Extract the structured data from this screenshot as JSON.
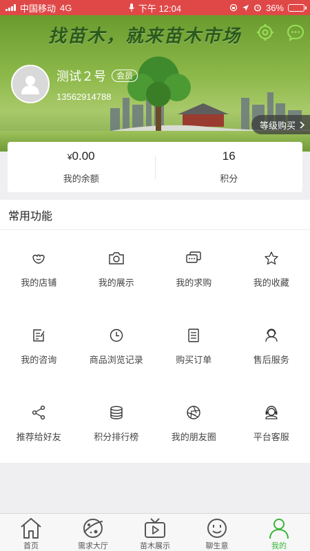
{
  "status_bar": {
    "carrier": "中国移动",
    "network": "4G",
    "time": "下午 12:04",
    "battery": "36%",
    "battery_level": 0.36,
    "color": "#e04848"
  },
  "banner": {
    "slogan": "找苗木，就来苗木市场",
    "level_button": "等级购买",
    "level_chevron": "chevron-right-icon"
  },
  "profile": {
    "name": "测试２号",
    "badge": "会员",
    "phone": "13562914788"
  },
  "stats": [
    {
      "currency": "¥",
      "value": "0.00",
      "label": "我的余额"
    },
    {
      "currency": "",
      "value": "16",
      "label": "积分"
    }
  ],
  "functions": {
    "title": "常用功能",
    "items": [
      {
        "label": "我的店铺",
        "icon": "shop-icon"
      },
      {
        "label": "我的展示",
        "icon": "camera-icon"
      },
      {
        "label": "我的求购",
        "icon": "chat-bubbles-icon"
      },
      {
        "label": "我的收藏",
        "icon": "star-icon"
      },
      {
        "label": "我的咨询",
        "icon": "edit-note-icon"
      },
      {
        "label": "商品浏览记录",
        "icon": "clock-icon"
      },
      {
        "label": "购买订单",
        "icon": "order-list-icon"
      },
      {
        "label": "售后服务",
        "icon": "user-service-icon"
      },
      {
        "label": "推荐给好友",
        "icon": "share-icon"
      },
      {
        "label": "积分排行榜",
        "icon": "database-icon"
      },
      {
        "label": "我的朋友圈",
        "icon": "aperture-icon"
      },
      {
        "label": "平台客服",
        "icon": "headset-icon"
      }
    ]
  },
  "tabbar": {
    "active_color": "#39b53a",
    "tabs": [
      {
        "label": "首页",
        "icon": "home-icon"
      },
      {
        "label": "需求大厅",
        "icon": "planet-icon"
      },
      {
        "label": "苗木展示",
        "icon": "tv-play-icon"
      },
      {
        "label": "聊生意",
        "icon": "smile-face-icon"
      },
      {
        "label": "我的",
        "icon": "person-icon"
      }
    ]
  }
}
